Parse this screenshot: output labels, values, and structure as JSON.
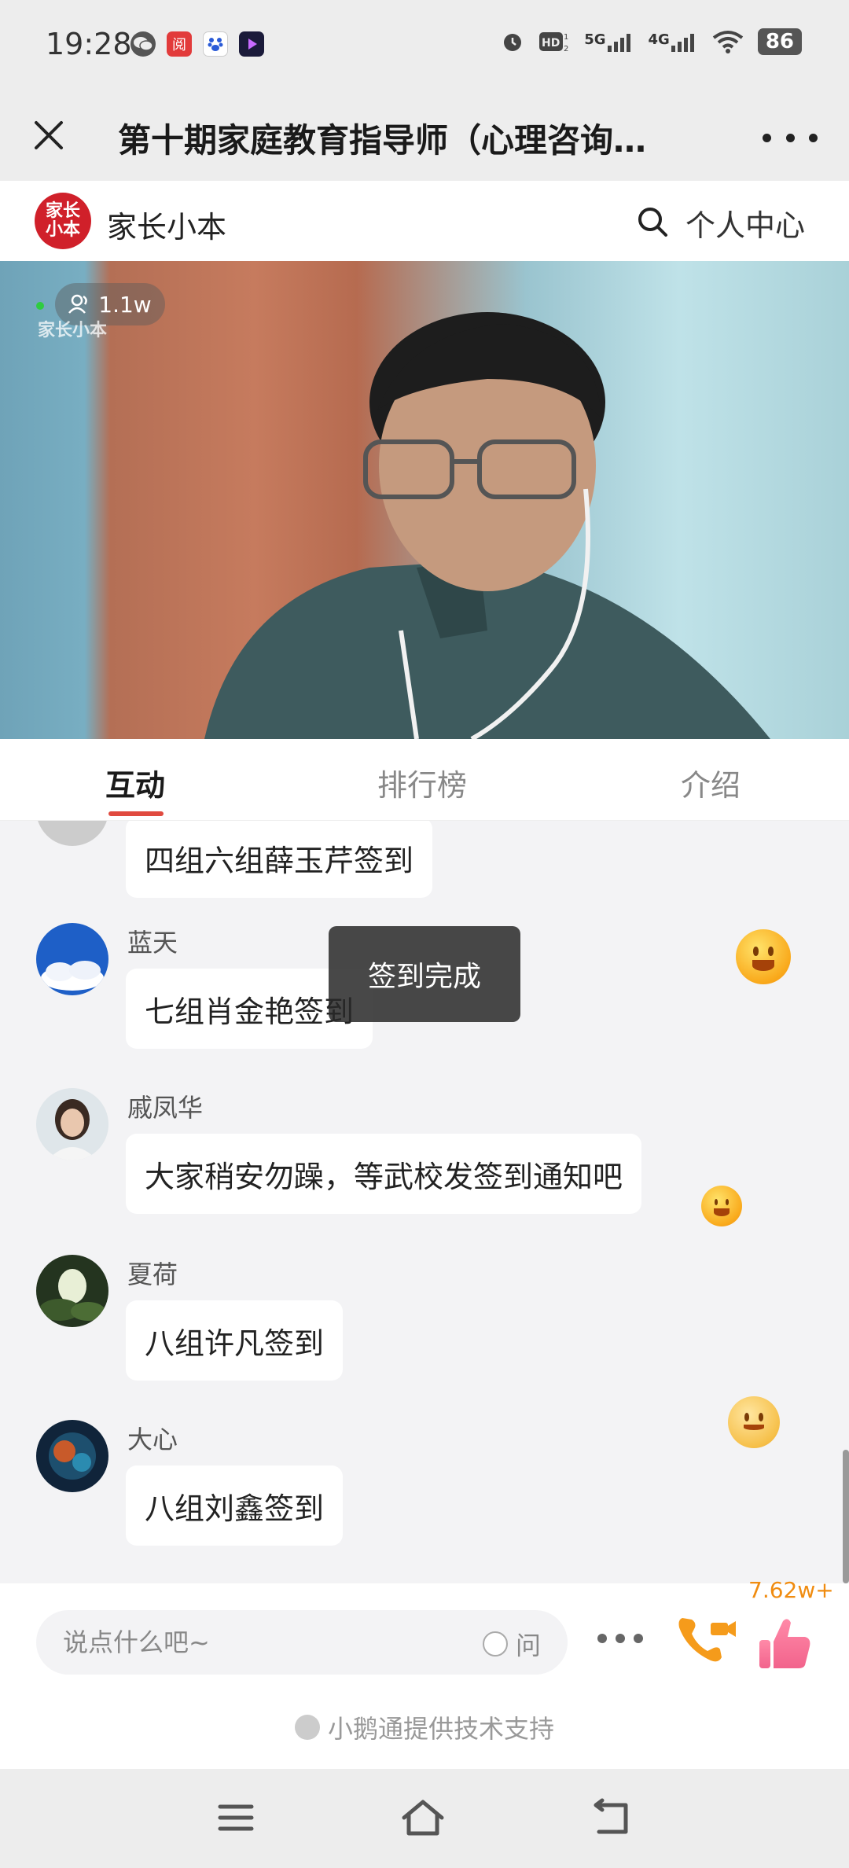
{
  "status_bar": {
    "time": "19:28",
    "apps": [
      "wechat-icon",
      "news-app-icon",
      "baidu-icon",
      "video-app-icon"
    ],
    "network": [
      "5G",
      "4G"
    ],
    "battery": "86"
  },
  "header": {
    "title": "第十期家庭教育指导师（心理咨询…"
  },
  "brand": {
    "logo_text": "家长小本",
    "name": "家长小本",
    "personal_center": "个人中心"
  },
  "video": {
    "viewers": "1.1w",
    "watermark": "家长小本"
  },
  "tabs": [
    {
      "label": "互动",
      "active": true
    },
    {
      "label": "排行榜",
      "active": false
    },
    {
      "label": "介绍",
      "active": false
    }
  ],
  "messages": [
    {
      "name": "",
      "text": "四组六组薛玉芹签到"
    },
    {
      "name": "蓝天",
      "text": "七组肖金艳签到"
    },
    {
      "name": "戚凤华",
      "text": "大家稍安勿躁，等武校发签到通知吧"
    },
    {
      "name": "夏荷",
      "text": "八组许凡签到"
    },
    {
      "name": "大心",
      "text": "八组刘鑫签到"
    }
  ],
  "toast": "签到完成",
  "input": {
    "placeholder": "说点什么吧~",
    "ask_label": "问"
  },
  "likes": "7.62w+",
  "tech_support": "小鹅通提供技术支持",
  "colors": {
    "accent": "#e04a3f",
    "brand": "#d0202a",
    "like": "#f08c10"
  }
}
